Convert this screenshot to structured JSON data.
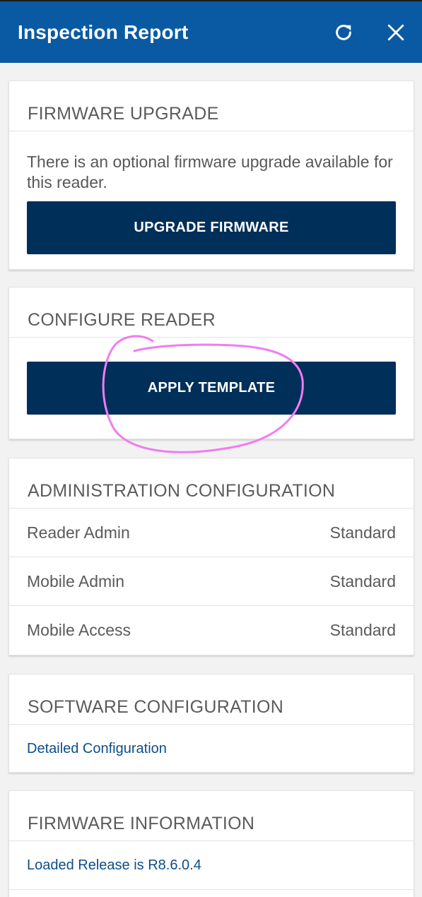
{
  "header": {
    "title": "Inspection Report",
    "refresh_icon": "refresh-icon",
    "close_icon": "close-icon",
    "background_color": "#0a5aa3"
  },
  "firmware_upgrade": {
    "title": "FIRMWARE UPGRADE",
    "description": "There is an optional firmware upgrade available for this reader.",
    "button_label": "UPGRADE FIRMWARE"
  },
  "configure_reader": {
    "title": "CONFIGURE READER",
    "button_label": "APPLY TEMPLATE"
  },
  "administration": {
    "title": "ADMINISTRATION CONFIGURATION",
    "rows": [
      {
        "label": "Reader Admin",
        "value": "Standard"
      },
      {
        "label": "Mobile Admin",
        "value": "Standard"
      },
      {
        "label": "Mobile Access",
        "value": "Standard"
      }
    ]
  },
  "software": {
    "title": "SOFTWARE CONFIGURATION",
    "link_label": "Detailed Configuration"
  },
  "firmware_info": {
    "title": "FIRMWARE INFORMATION",
    "release_label": "Loaded Release is R8.6.0.4"
  },
  "colors": {
    "button_background": "#002f5a",
    "link": "#0d4e8a",
    "annotation_circle": "#f07cf0"
  }
}
